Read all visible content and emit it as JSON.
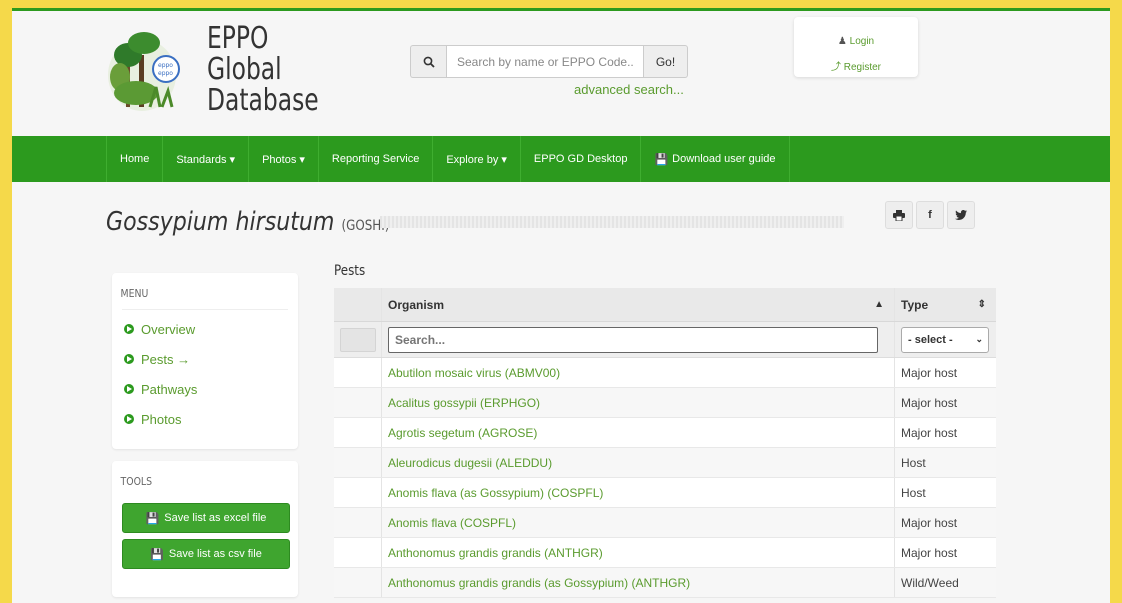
{
  "header": {
    "brand_line1": "EPPO",
    "brand_line2": "Global",
    "brand_line3": "Database",
    "search_placeholder": "Search by name or EPPO Code...",
    "go_label": "Go!",
    "advanced_search": "advanced search...",
    "login": "Login",
    "register": "Register"
  },
  "nav": {
    "items": [
      "Home",
      "Standards ▾",
      "Photos ▾",
      "Reporting Service",
      "Explore by ▾",
      "EPPO GD Desktop",
      "Download user guide"
    ]
  },
  "page": {
    "title_species": "Gossypium hirsutum",
    "title_code": "(GOSHI)"
  },
  "sidebar": {
    "menu_title": "MENU",
    "menu_items": [
      "Overview",
      "Pests →",
      "Pathways",
      "Photos"
    ],
    "tools_title": "TOOLS",
    "save_excel": "Save list as excel file",
    "save_csv": "Save list as csv file"
  },
  "table": {
    "section_label": "Pests",
    "col_organism": "Organism",
    "col_type": "Type",
    "search_placeholder": "Search...",
    "type_select": "- select -",
    "rows": [
      {
        "organism": "Abutilon mosaic virus (ABMV00)",
        "type": "Major host"
      },
      {
        "organism": "Acalitus gossypii (ERPHGO)",
        "type": "Major host"
      },
      {
        "organism": "Agrotis segetum (AGROSE)",
        "type": "Major host"
      },
      {
        "organism": "Aleurodicus dugesii (ALEDDU)",
        "type": "Host"
      },
      {
        "organism": "Anomis flava (as Gossypium) (COSPFL)",
        "type": "Host"
      },
      {
        "organism": "Anomis flava (COSPFL)",
        "type": "Major host"
      },
      {
        "organism": "Anthonomus grandis grandis (ANTHGR)",
        "type": "Major host"
      },
      {
        "organism": "Anthonomus grandis grandis (as Gossypium) (ANTHGR)",
        "type": "Wild/Weed"
      }
    ]
  },
  "colors": {
    "brand_green": "#2c9a1e",
    "link_green": "#5a9b2e",
    "frame_yellow": "#f5d94a"
  }
}
